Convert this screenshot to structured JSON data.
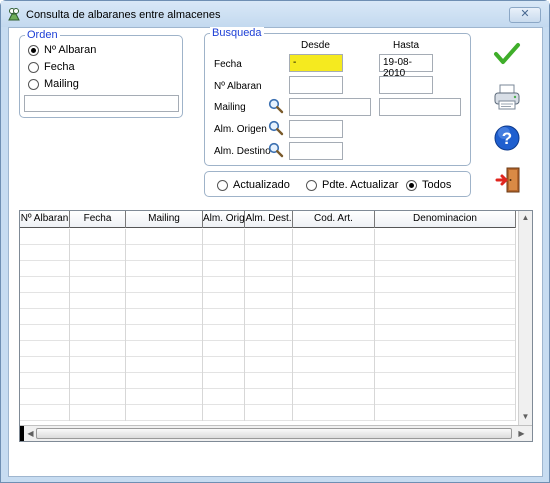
{
  "window": {
    "title": "Consulta de albaranes entre almacenes",
    "close_label": "✕"
  },
  "orden": {
    "legend": "Orden",
    "options": [
      {
        "label": "Nº Albaran",
        "checked": true
      },
      {
        "label": "Fecha",
        "checked": false
      },
      {
        "label": "Mailing",
        "checked": false
      }
    ],
    "text_value": ""
  },
  "busqueda": {
    "legend": "Busqueda",
    "col_from": "Desde",
    "col_to": "Hasta",
    "rows": [
      {
        "label": "Fecha",
        "from": " - ",
        "to": "19-08-2010"
      },
      {
        "label": "Nº Albaran",
        "from": "",
        "to": ""
      },
      {
        "label": "Mailing",
        "from": "",
        "to": ""
      },
      {
        "label": "Alm. Origen",
        "from": ""
      },
      {
        "label": "Alm. Destino",
        "from": ""
      }
    ]
  },
  "estado": {
    "options": [
      {
        "label": "Actualizado",
        "checked": false
      },
      {
        "label": "Pdte. Actualizar",
        "checked": false
      },
      {
        "label": "Todos",
        "checked": true
      }
    ]
  },
  "grid": {
    "columns": [
      "Nº Albaran",
      "Fecha",
      "Mailing",
      "Alm. Orig.",
      "Alm. Dest.",
      "Cod. Art.",
      "Denominacion"
    ],
    "empty_rows": 12
  },
  "icons": {
    "accept": "checkmark-icon",
    "print": "printer-icon",
    "help": "help-icon",
    "exit": "exit-door-icon",
    "search": "magnifier-icon"
  },
  "colors": {
    "legend": "#1d3fd6",
    "date_highlight": "#f5ea1f",
    "accept_green": "#3fae2a",
    "help_blue": "#1f5fcf"
  }
}
